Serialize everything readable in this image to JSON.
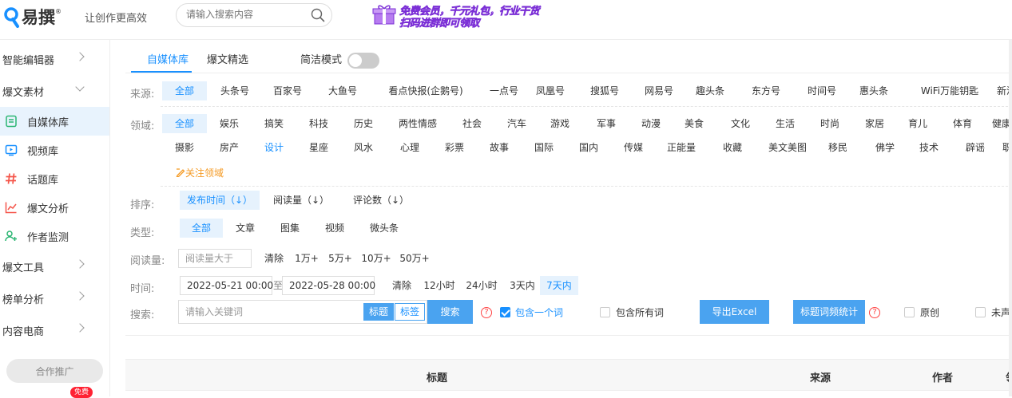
{
  "header": {
    "logo_text": "易撰",
    "logo_mark": "®",
    "slogan": "让创作更高效",
    "search_placeholder": "请输入搜索内容",
    "promo_line1": "免费会员，千元礼包，行业干货",
    "promo_line2": "扫码进群即可领取"
  },
  "sidebar": {
    "groups": {
      "editor": "智能编辑器",
      "material": "爆文素材",
      "tools": "爆文工具",
      "ranking": "榜单分析",
      "ecommerce": "内容电商"
    },
    "items": [
      {
        "label": "自媒体库",
        "icon": "document-icon"
      },
      {
        "label": "视频库",
        "icon": "video-icon"
      },
      {
        "label": "话题库",
        "icon": "hashtag-icon"
      },
      {
        "label": "爆文分析",
        "icon": "chart-line-icon"
      },
      {
        "label": "作者监测",
        "icon": "user-add-icon"
      }
    ],
    "promo_button": "合作推广",
    "free_badge": "免费"
  },
  "tabs": {
    "media_lib": "自媒体库",
    "hot_picks": "爆文精选",
    "simple_mode": "简洁模式"
  },
  "filters": {
    "source_label": "来源:",
    "sources": [
      "全部",
      "头条号",
      "百家号",
      "大鱼号",
      "看点快报(企鹅号)",
      "一点号",
      "凤凰号",
      "搜狐号",
      "网易号",
      "趣头条",
      "东方号",
      "时间号",
      "惠头条",
      "WiFi万能钥匙",
      "新浪"
    ],
    "domain_label": "领域:",
    "domains_row1": [
      "全部",
      "娱乐",
      "搞笑",
      "科技",
      "历史",
      "两性情感",
      "社会",
      "汽车",
      "游戏",
      "军事",
      "动漫",
      "美食",
      "文化",
      "生活",
      "时尚",
      "家居",
      "育儿",
      "体育",
      "健康"
    ],
    "domains_row2": [
      "摄影",
      "房产",
      "设计",
      "星座",
      "风水",
      "心理",
      "彩票",
      "故事",
      "国际",
      "国内",
      "传媒",
      "正能量",
      "收藏",
      "美文美图",
      "移民",
      "佛学",
      "技术",
      "辟谣",
      "职"
    ],
    "follow_domain": "关注领域",
    "sort_label": "排序:",
    "sorts": [
      "发布时间（↓）",
      "阅读量（↓）",
      "评论数（↓）"
    ],
    "type_label": "类型:",
    "types": [
      "全部",
      "文章",
      "图集",
      "视频",
      "微头条"
    ],
    "reads_label": "阅读量:",
    "reads_placeholder": "阅读量大于",
    "reads_options": [
      "清除",
      "1万+",
      "5万+",
      "10万+",
      "50万+"
    ],
    "time_label": "时间:",
    "time_from": "2022-05-21 00:00",
    "time_to_sep": "至",
    "time_to": "2022-05-28 00:00",
    "time_options": [
      "清除",
      "12小时",
      "24小时",
      "3天内",
      "7天内"
    ],
    "search_label": "搜索:",
    "keyword_placeholder": "请输入关键词",
    "scope_title": "标题",
    "scope_tag": "标签",
    "search_button": "搜索",
    "contains_one": "包含一个词",
    "contains_all": "包含所有词",
    "export_button": "导出Excel",
    "word_freq_button": "标题词频统计",
    "original": "原创",
    "undeclared": "未声明"
  },
  "table": {
    "headers": [
      "标题",
      "来源",
      "作者",
      "领"
    ]
  },
  "colors": {
    "accent": "#1890ff",
    "button_blue": "#4aa3f0",
    "selected_bg": "#e6f2fd",
    "warning": "#f59a23"
  }
}
